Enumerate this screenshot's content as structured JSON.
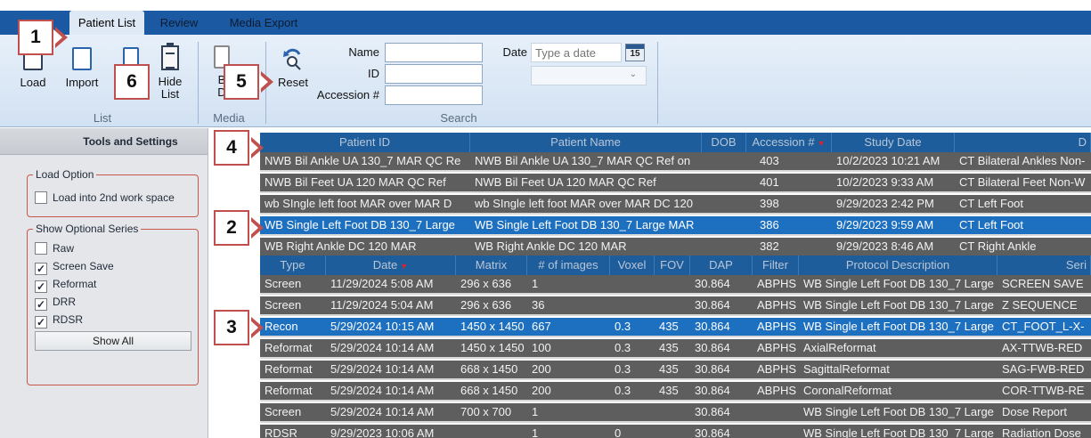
{
  "tabs": [
    {
      "label": "Patient List",
      "active": true
    },
    {
      "label": "Review",
      "active": false
    },
    {
      "label": "Media Export",
      "active": false
    }
  ],
  "ribbon": {
    "list_group": {
      "label": "List",
      "load": "Load",
      "import": "Import",
      "hide_list_line1": "Hide",
      "hide_list_line2": "List"
    },
    "media_group": {
      "label": "Media",
      "burn_line1": "B",
      "burn_line2": "D"
    },
    "search_group": {
      "label": "Search",
      "reset": "Reset",
      "name_label": "Name",
      "name_value": "",
      "id_label": "ID",
      "id_value": "",
      "accession_label": "Accession #",
      "accession_value": "",
      "date_label": "Date",
      "date_placeholder": "Type a date",
      "calendar_day": "15",
      "combo_value": ""
    }
  },
  "tools_panel": {
    "title": "Tools and Settings",
    "load_option": {
      "title": "Load Option",
      "items": [
        {
          "label": "Load into 2nd work space",
          "checked": false
        }
      ]
    },
    "optional_series": {
      "title": "Show Optional Series",
      "items": [
        {
          "label": "Raw",
          "checked": false,
          "mark": ""
        },
        {
          "label": "Screen Save",
          "checked": true,
          "mark": "✓"
        },
        {
          "label": "Reformat",
          "checked": true,
          "mark": "✓"
        },
        {
          "label": "DRR",
          "checked": true,
          "mark": "✓"
        },
        {
          "label": "RDSR",
          "checked": true,
          "mark": "✓"
        }
      ],
      "show_all": "Show All"
    }
  },
  "patient_grid": {
    "columns": [
      "Patient ID",
      "Patient Name",
      "DOB",
      "Accession #",
      "Study Date",
      "D"
    ],
    "sort_arrow": "▼",
    "rows": [
      [
        "NWB Bil Ankle UA 130_7 MAR QC Re",
        "NWB Bil Ankle UA 130_7 MAR QC Ref on",
        "",
        "403",
        "10/2/2023 10:21 AM",
        "CT Bilateral Ankles Non-"
      ],
      [
        "NWB Bil Feet  UA 120 MAR QC Ref",
        "NWB Bil Feet  UA 120 MAR QC Ref",
        "",
        "401",
        "10/2/2023 9:33 AM",
        "CT Bilateral Feet Non-W"
      ],
      [
        "wb SIngle left foot MAR over MAR D",
        "wb SIngle left foot MAR over MAR DC 120",
        "",
        "398",
        "9/29/2023 2:42 PM",
        "CT Left Foot"
      ],
      [
        "WB Single Left Foot DB 130_7 Large",
        "WB Single Left Foot DB 130_7 Large MAR",
        "",
        "386",
        "9/29/2023 9:59 AM",
        "CT Left Foot"
      ],
      [
        "WB Right Ankle DC 120 MAR",
        "WB Right Ankle DC 120 MAR",
        "",
        "382",
        "9/29/2023 8:46 AM",
        "CT Right Ankle"
      ]
    ],
    "selected_row": 3
  },
  "series_grid": {
    "columns": [
      "Type",
      "Date",
      "Matrix",
      "# of images",
      "Voxel",
      "FOV",
      "DAP",
      "Filter",
      "Protocol Description",
      "Seri"
    ],
    "sort_arrow": "▼",
    "rows": [
      [
        "Screen",
        "11/29/2024 5:08 AM",
        "296 x 636",
        "1",
        "",
        "",
        "30.864",
        "ABPHS",
        "WB Single Left Foot DB 130_7 Large",
        "SCREEN SAVE"
      ],
      [
        "Screen",
        "11/29/2024 5:04 AM",
        "296 x 636",
        "36",
        "",
        "",
        "30.864",
        "ABPHS",
        "WB Single Left Foot DB 130_7 Large",
        "Z SEQUENCE"
      ],
      [
        "Recon",
        "5/29/2024 10:15 AM",
        "1450 x 1450",
        "667",
        "0.3",
        "435",
        "30.864",
        "ABPHS",
        "WB Single Left Foot DB 130_7 Large",
        "CT_FOOT_L-X-"
      ],
      [
        "Reformat",
        "5/29/2024 10:14 AM",
        "1450 x 1450",
        "100",
        "0.3",
        "435",
        "30.864",
        "ABPHS",
        "AxialReformat",
        "AX-TTWB-RED"
      ],
      [
        "Reformat",
        "5/29/2024 10:14 AM",
        "668 x 1450",
        "200",
        "0.3",
        "435",
        "30.864",
        "ABPHS",
        "SagittalReformat",
        "SAG-FWB-RED"
      ],
      [
        "Reformat",
        "5/29/2024 10:14 AM",
        "668 x 1450",
        "200",
        "0.3",
        "435",
        "30.864",
        "ABPHS",
        "CoronalReformat",
        "COR-TTWB-RE"
      ],
      [
        "Screen",
        "5/29/2024 10:14 AM",
        "700 x 700",
        "1",
        "",
        "",
        "30.864",
        "",
        "WB Single Left Foot DB 130_7 Large",
        "Dose Report"
      ],
      [
        "RDSR",
        "9/29/2023 10:06 AM",
        "",
        "1",
        "0",
        "",
        "30.864",
        "",
        "WB Single Left Foot DB 130_7 Large",
        "Radiation Dose"
      ]
    ],
    "selected_row": 2
  },
  "callouts": [
    "1",
    "2",
    "3",
    "4",
    "5",
    "6"
  ],
  "colors": {
    "ribbon_blue": "#1b5aa3",
    "grid_header": "#1d5d9c",
    "row_gray": "#5e5e5e",
    "selected_blue": "#1d6fc0",
    "callout_border": "#c0504d"
  }
}
